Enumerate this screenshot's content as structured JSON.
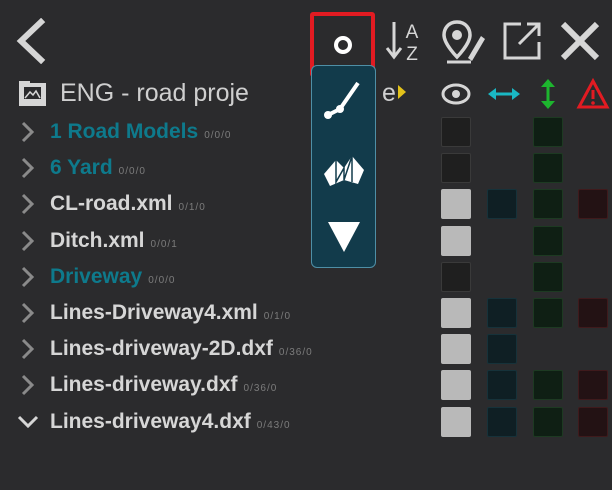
{
  "header": {
    "folder_title": "ENG - road proje",
    "title_suffix": "e"
  },
  "toolbar": {
    "back": "back-arrow-icon",
    "point_mode_selected": true,
    "sort_icon_letters": {
      "top": "A",
      "bottom": "Z"
    },
    "map_pin_edit": "map-pin-edit-icon",
    "expand": "expand-icon",
    "close": "close-icon"
  },
  "point_popup": {
    "items": [
      "polyline-icon",
      "surface-icon",
      "triangle-point-icon"
    ]
  },
  "columns": [
    "eye-icon",
    "horizontal-arrows-icon",
    "vertical-arrows-icon",
    "warning-icon"
  ],
  "rows": [
    {
      "name": "1 Road Models",
      "counts": "0/0/0",
      "color": "#0e7a8c",
      "expanded": false,
      "vis": "off",
      "blue": false,
      "green": true,
      "red": false
    },
    {
      "name": "6 Yard",
      "counts": "0/0/0",
      "color": "#0e7a8c",
      "expanded": false,
      "vis": "off",
      "blue": false,
      "green": true,
      "red": false
    },
    {
      "name": "CL-road.xml",
      "counts": "0/1/0",
      "color": "#d6d6d6",
      "expanded": false,
      "vis": "on",
      "blue": true,
      "green": true,
      "red": true
    },
    {
      "name": "Ditch.xml",
      "counts": "0/0/1",
      "color": "#d6d6d6",
      "expanded": false,
      "vis": "on",
      "blue": false,
      "green": true,
      "red": false
    },
    {
      "name": "Driveway",
      "counts": "0/0/0",
      "color": "#0e7a8c",
      "expanded": false,
      "vis": "off",
      "blue": false,
      "green": true,
      "red": false
    },
    {
      "name": "Lines-Driveway4.xml",
      "counts": "0/1/0",
      "color": "#d6d6d6",
      "expanded": false,
      "vis": "on",
      "blue": true,
      "green": true,
      "red": true
    },
    {
      "name": "Lines-driveway-2D.dxf",
      "counts": "0/36/0",
      "color": "#d6d6d6",
      "expanded": false,
      "vis": "on",
      "blue": true,
      "green": false,
      "red": false
    },
    {
      "name": "Lines-driveway.dxf",
      "counts": "0/36/0",
      "color": "#d6d6d6",
      "expanded": false,
      "vis": "on",
      "blue": true,
      "green": true,
      "red": true
    },
    {
      "name": "Lines-driveway4.dxf",
      "counts": "0/43/0",
      "color": "#d6d6d6",
      "expanded": true,
      "vis": "on",
      "blue": true,
      "green": true,
      "red": true
    }
  ],
  "colors": {
    "background": "#2b2b2d",
    "folder_blue": "#0e7a8c",
    "file_text": "#d6d6d6",
    "selection_red": "#e21b22",
    "accent_cyan": "#1ab8c4",
    "accent_green": "#1db52e",
    "warning_red": "#e21b22"
  }
}
